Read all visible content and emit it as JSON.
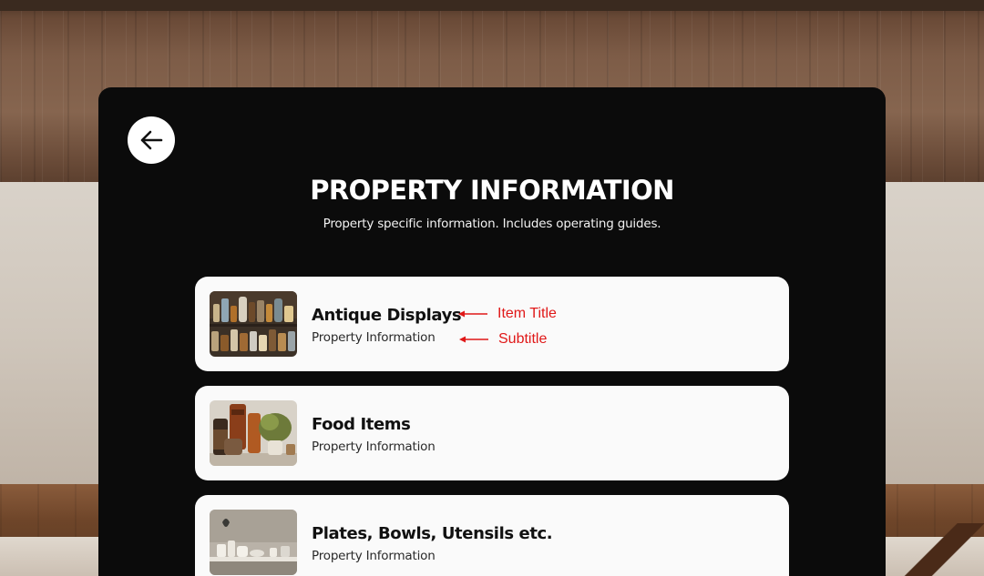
{
  "header": {
    "back_icon": "arrow-left-icon",
    "title": "PROPERTY INFORMATION",
    "subtitle": "Property specific information. Includes operating guides."
  },
  "items": [
    {
      "title": "Antique Displays",
      "subtitle": "Property Information",
      "thumbnail": "antique-bottles-thumbnail"
    },
    {
      "title": "Food Items",
      "subtitle": "Property Information",
      "thumbnail": "food-jars-thumbnail"
    },
    {
      "title": "Plates, Bowls, Utensils etc.",
      "subtitle": "Property Information",
      "thumbnail": "kitchen-shelf-thumbnail"
    }
  ],
  "annotations": {
    "item_title": "Item Title",
    "subtitle": "Subtitle",
    "color": "#e01818"
  },
  "colors": {
    "panel": "#0b0b0b",
    "card": "#fafafa",
    "text_on_dark": "#ffffff"
  }
}
